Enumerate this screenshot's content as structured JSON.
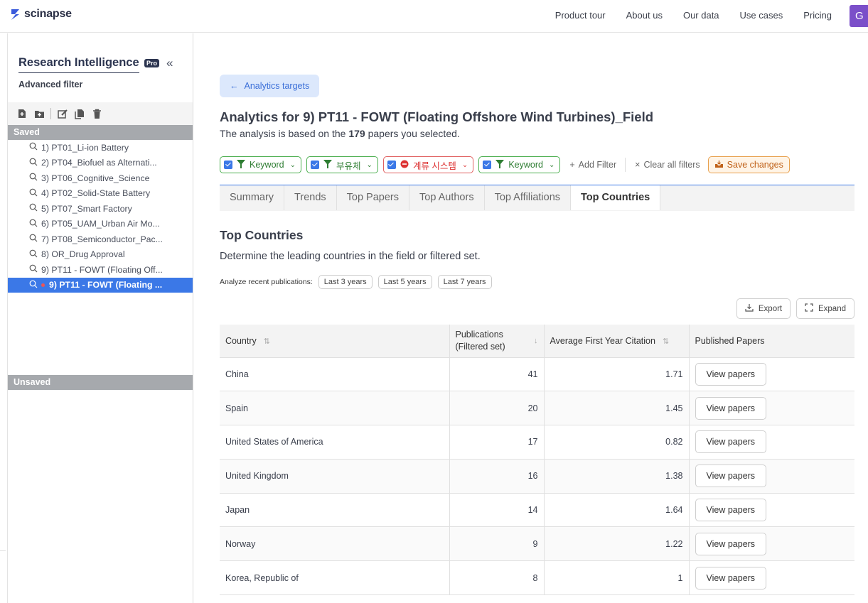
{
  "brand": {
    "name": "scinapse",
    "accent": "#3b5bdb"
  },
  "nav": {
    "links": [
      "Product tour",
      "About us",
      "Our data",
      "Use cases",
      "Pricing"
    ],
    "avatar_initial": "G"
  },
  "sidebar": {
    "title": "Research Intelligence",
    "badge": "Pro",
    "advanced_filter": "Advanced filter",
    "saved_label": "Saved",
    "unsaved_label": "Unsaved",
    "saved_items": [
      "1) PT01_Li-ion Battery",
      "2) PT04_Biofuel as Alternati...",
      "3) PT06_Cognitive_Science",
      "4) PT02_Solid-State Battery",
      "5) PT07_Smart Factory",
      "6) PT05_UAM_Urban Air Mo...",
      "7) PT08_Semiconductor_Pac...",
      "8) OR_Drug Approval",
      "9) PT11 - FOWT (Floating Off...",
      "9) PT11 - FOWT (Floating ..."
    ]
  },
  "main": {
    "back_button": "Analytics targets",
    "title": "Analytics for 9) PT11 - FOWT (Floating Offshore Wind Turbines)_Field",
    "subtitle_before": "The analysis is based on the ",
    "subtitle_count": "179",
    "subtitle_after": " papers you selected.",
    "filters": [
      {
        "label": "Keyword",
        "kind": "include"
      },
      {
        "label": "부유체",
        "kind": "include"
      },
      {
        "label": "계류 시스템",
        "kind": "exclude"
      },
      {
        "label": "Keyword",
        "kind": "include"
      }
    ],
    "add_filter": "Add Filter",
    "clear_filters": "Clear all filters",
    "save_changes": "Save changes",
    "tabs": [
      "Summary",
      "Trends",
      "Top Papers",
      "Top Authors",
      "Top Affiliations",
      "Top Countries"
    ],
    "active_tab": "Top Countries",
    "section_title": "Top Countries",
    "section_desc": "Determine the leading countries in the field or filtered set.",
    "recent_label": "Analyze recent publications:",
    "recent_options": [
      "Last 3 years",
      "Last 5 years",
      "Last 7 years"
    ],
    "export": "Export",
    "expand": "Expand",
    "table": {
      "headers": [
        "Country",
        "Publications (Filtered set)",
        "Average First Year Citation",
        "Published Papers"
      ],
      "button_label": "View papers",
      "rows": [
        {
          "country": "China",
          "pubs": "41",
          "cit": "1.71"
        },
        {
          "country": "Spain",
          "pubs": "20",
          "cit": "1.45"
        },
        {
          "country": "United States of America",
          "pubs": "17",
          "cit": "0.82"
        },
        {
          "country": "United Kingdom",
          "pubs": "16",
          "cit": "1.38"
        },
        {
          "country": "Japan",
          "pubs": "14",
          "cit": "1.64"
        },
        {
          "country": "Norway",
          "pubs": "9",
          "cit": "1.22"
        },
        {
          "country": "Korea, Republic of",
          "pubs": "8",
          "cit": "1"
        }
      ]
    }
  }
}
